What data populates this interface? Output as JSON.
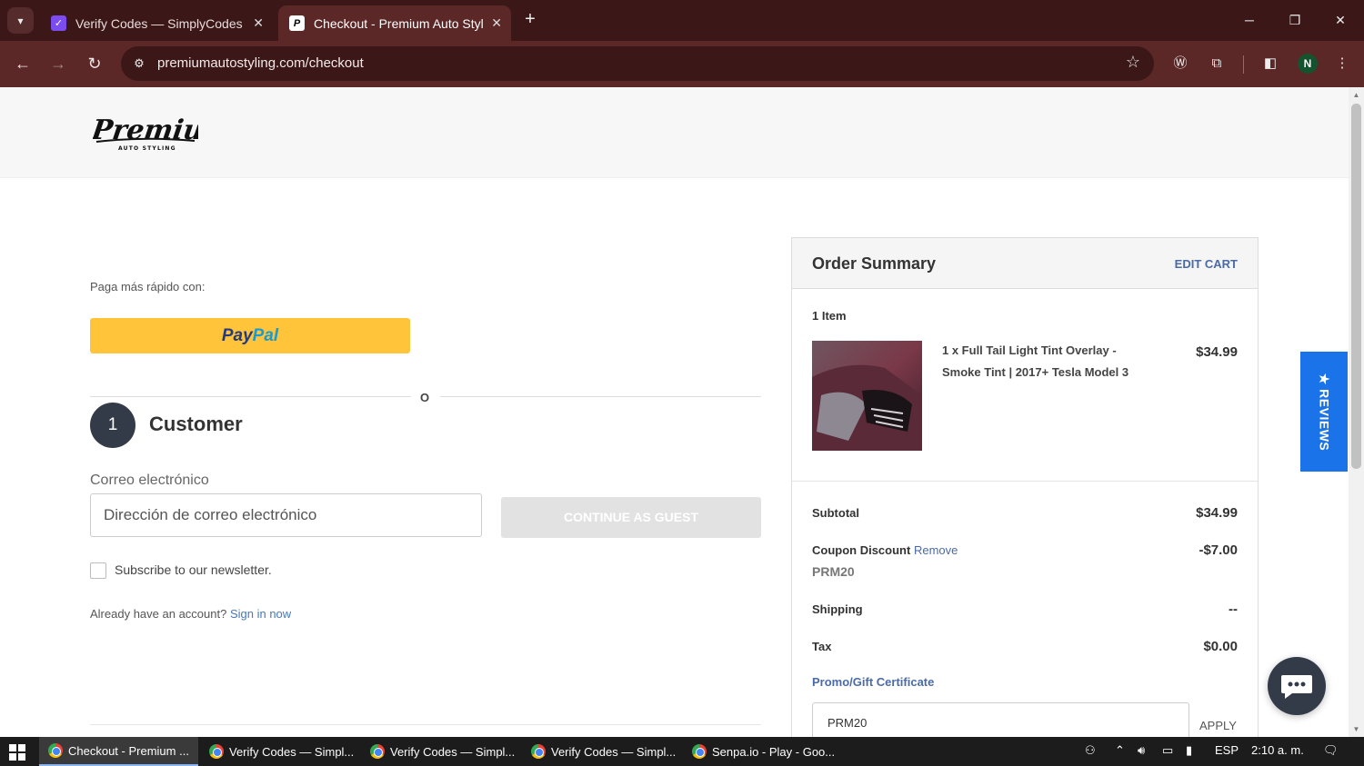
{
  "browser": {
    "tabs": [
      {
        "title": "Verify Codes — SimplyCodes",
        "active": false
      },
      {
        "title": "Checkout - Premium Auto Styling",
        "active": true
      }
    ],
    "url": "premiumautostyling.com/checkout",
    "profile_initial": "N"
  },
  "header": {
    "logo_text": "Premium",
    "logo_subtext": "AUTO STYLING"
  },
  "checkout": {
    "fast_pay_label": "Paga más rápido con:",
    "paypal": {
      "pay": "Pay",
      "pal": "Pal"
    },
    "or_separator": "O",
    "step_number": "1",
    "step_title": "Customer",
    "email_label": "Correo electrónico",
    "email_placeholder": "Dirección de correo electrónico",
    "email_value": "",
    "continue_button": "CONTINUE AS GUEST",
    "newsletter_label": "Subscribe to our newsletter.",
    "newsletter_checked": false,
    "account_prompt": "Already have an account?",
    "signin_link": "Sign in now"
  },
  "order_summary": {
    "title": "Order Summary",
    "edit_cart": "EDIT CART",
    "items_count": "1 Item",
    "items": [
      {
        "name": "1 x Full Tail Light Tint Overlay - Smoke Tint | 2017+ Tesla Model 3",
        "price": "$34.99"
      }
    ],
    "subtotal_label": "Subtotal",
    "subtotal_value": "$34.99",
    "coupon_label": "Coupon Discount",
    "coupon_remove": "Remove",
    "coupon_code": "PRM20",
    "coupon_value": "-$7.00",
    "shipping_label": "Shipping",
    "shipping_value": "--",
    "tax_label": "Tax",
    "tax_value": "$0.00",
    "promo_link": "Promo/Gift Certificate",
    "promo_value": "PRM20",
    "apply_button": "APPLY"
  },
  "widgets": {
    "reviews_label": "★ REVIEWS"
  },
  "taskbar": {
    "tasks": [
      {
        "label": "Checkout - Premium ...",
        "active": true
      },
      {
        "label": "Verify Codes — Simpl...",
        "active": false
      },
      {
        "label": "Verify Codes — Simpl...",
        "active": false
      },
      {
        "label": "Verify Codes — Simpl...",
        "active": false
      },
      {
        "label": "Senpa.io - Play - Goo...",
        "active": false
      }
    ],
    "language": "ESP",
    "time": "2:10 a. m."
  },
  "colors": {
    "chrome_dark": "#3b1717",
    "chrome_toolbar": "#5b2727",
    "paypal_yellow": "#ffc439",
    "link_blue": "#4a6aa8",
    "reviews_blue": "#1a73e8",
    "step_circle": "#333a48"
  }
}
